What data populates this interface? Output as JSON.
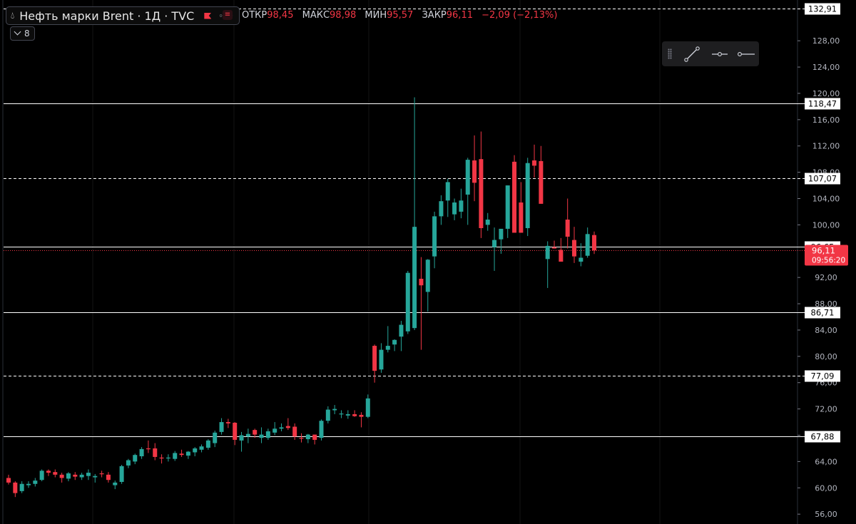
{
  "header": {
    "symbol_title": "Нефть марки Brent · 1Д · TVC",
    "ohlc": [
      {
        "label": "ОТКР",
        "value": "98,45"
      },
      {
        "label": "МАКС",
        "value": "98,98"
      },
      {
        "label": "МИН",
        "value": "95,57"
      },
      {
        "label": "ЗАКР",
        "value": "96,11"
      }
    ],
    "change": "−2,09 (−2,13%)",
    "collapse_count": "8"
  },
  "price_scale": {
    "ticks": [
      "128,00",
      "124,00",
      "120,00",
      "116,00",
      "112,00",
      "108,00",
      "104,00",
      "100,00",
      "92,00",
      "88,00",
      "84,00",
      "80,00",
      "76,00",
      "72,00",
      "68,00",
      "64,00",
      "60,00",
      "56,00"
    ],
    "range": [
      54.5,
      134.2
    ]
  },
  "levels": [
    {
      "label": "132,91",
      "value": 132.91,
      "style": "dashed"
    },
    {
      "label": "118,47",
      "value": 118.47,
      "style": "solid"
    },
    {
      "label": "107,07",
      "value": 107.07,
      "style": "dashed"
    },
    {
      "label": "96,65",
      "value": 96.65,
      "style": "solid"
    },
    {
      "label": "86,71",
      "value": 86.71,
      "style": "solid"
    },
    {
      "label": "77,09",
      "value": 77.09,
      "style": "dashed"
    },
    {
      "label": "67,88",
      "value": 67.88,
      "style": "solid"
    }
  ],
  "last_price": {
    "label": "96,11",
    "countdown": "09:56:20",
    "value": 96.11,
    "color": "#f23645"
  },
  "colors": {
    "up": "#26a69a",
    "down": "#f23645",
    "background": "#000000",
    "line": "#ffffff"
  },
  "toolbar": {
    "icons": [
      "drag-handle-icon",
      "trend-line-icon",
      "horizontal-ray-icon",
      "horizontal-line-icon"
    ]
  },
  "chart_data": {
    "type": "candlestick",
    "y_axis_ticks": [
      "128,00",
      "124,00",
      "120,00",
      "116,00",
      "112,00",
      "108,00",
      "104,00",
      "100,00",
      "92,00",
      "88,00",
      "84,00",
      "80,00",
      "76,00",
      "72,00",
      "68,00",
      "64,00",
      "60,00",
      "56,00"
    ],
    "candles": [
      [
        61.5,
        62.0,
        60.5,
        60.8
      ],
      [
        60.8,
        61.0,
        58.6,
        59.2
      ],
      [
        59.5,
        61.0,
        59.2,
        60.6
      ],
      [
        60.4,
        61.0,
        60.0,
        60.6
      ],
      [
        60.6,
        61.5,
        60.2,
        61.1
      ],
      [
        61.2,
        62.8,
        61.0,
        62.6
      ],
      [
        62.6,
        62.8,
        61.8,
        62.3
      ],
      [
        62.4,
        62.8,
        61.6,
        62.0
      ],
      [
        62.0,
        62.3,
        60.8,
        61.5
      ],
      [
        61.4,
        62.4,
        61.0,
        62.2
      ],
      [
        62.0,
        62.4,
        61.2,
        61.7
      ],
      [
        61.6,
        62.3,
        61.2,
        62.0
      ],
      [
        61.8,
        62.8,
        61.2,
        62.3
      ],
      [
        61.6,
        62.1,
        60.8,
        61.8
      ],
      [
        62.2,
        62.6,
        61.6,
        62.1
      ],
      [
        62.0,
        62.4,
        60.8,
        61.2
      ],
      [
        60.4,
        61.1,
        59.8,
        60.8
      ],
      [
        60.9,
        63.5,
        60.6,
        63.3
      ],
      [
        63.4,
        64.4,
        63.0,
        64.2
      ],
      [
        64.0,
        65.2,
        63.6,
        65.0
      ],
      [
        64.8,
        66.2,
        64.4,
        65.9
      ],
      [
        66.0,
        67.2,
        65.3,
        65.9
      ],
      [
        66.0,
        66.8,
        64.2,
        64.7
      ],
      [
        64.6,
        65.1,
        63.7,
        64.5
      ],
      [
        64.6,
        65.1,
        64.0,
        64.6
      ],
      [
        64.4,
        65.6,
        64.1,
        65.3
      ],
      [
        65.2,
        65.8,
        64.7,
        65.0
      ],
      [
        64.9,
        65.6,
        64.4,
        65.5
      ],
      [
        65.4,
        66.2,
        64.8,
        66.0
      ],
      [
        65.8,
        66.6,
        65.4,
        66.3
      ],
      [
        66.1,
        67.4,
        65.8,
        67.2
      ],
      [
        66.8,
        68.7,
        66.2,
        68.4
      ],
      [
        68.5,
        70.6,
        68.1,
        70.0
      ],
      [
        70.0,
        70.5,
        69.1,
        69.8
      ],
      [
        69.9,
        70.0,
        66.5,
        67.3
      ],
      [
        67.2,
        68.5,
        65.5,
        68.0
      ],
      [
        67.8,
        69.0,
        66.8,
        68.2
      ],
      [
        68.8,
        69.0,
        67.6,
        68.1
      ],
      [
        67.6,
        69.2,
        66.8,
        68.1
      ],
      [
        67.6,
        69.0,
        67.3,
        68.6
      ],
      [
        68.4,
        70.0,
        68.0,
        69.0
      ],
      [
        69.0,
        69.8,
        68.6,
        69.2
      ],
      [
        69.4,
        70.6,
        68.8,
        69.1
      ],
      [
        69.3,
        69.8,
        67.3,
        67.8
      ],
      [
        67.6,
        68.3,
        66.9,
        67.5
      ],
      [
        67.4,
        68.2,
        66.8,
        68.1
      ],
      [
        68.1,
        68.1,
        66.6,
        67.3
      ],
      [
        67.6,
        70.4,
        67.2,
        70.2
      ],
      [
        70.2,
        72.4,
        69.8,
        71.9
      ],
      [
        71.8,
        72.6,
        71.2,
        72.0
      ],
      [
        71.2,
        71.8,
        70.6,
        71.3
      ],
      [
        71.0,
        71.8,
        70.5,
        71.2
      ],
      [
        71.2,
        71.8,
        70.8,
        70.9
      ],
      [
        71.1,
        71.5,
        69.2,
        70.8
      ],
      [
        70.8,
        74.2,
        70.6,
        73.6
      ],
      [
        81.6,
        81.8,
        76.0,
        77.8
      ],
      [
        78.0,
        82.0,
        77.5,
        81.0
      ],
      [
        81.0,
        84.6,
        80.6,
        81.6
      ],
      [
        81.8,
        82.6,
        80.8,
        82.5
      ],
      [
        83.0,
        85.4,
        80.8,
        84.8
      ],
      [
        83.8,
        93.0,
        83.4,
        92.7
      ],
      [
        84.3,
        119.4,
        84.0,
        99.7
      ],
      [
        91.8,
        95.1,
        81.0,
        90.8
      ],
      [
        89.8,
        94.8,
        86.8,
        94.7
      ],
      [
        95.2,
        102.0,
        93.4,
        101.3
      ],
      [
        101.3,
        104.5,
        100.0,
        103.6
      ],
      [
        103.7,
        107.0,
        101.2,
        106.5
      ],
      [
        101.6,
        104.0,
        100.7,
        103.4
      ],
      [
        102.0,
        105.5,
        101.0,
        103.7
      ],
      [
        104.6,
        110.2,
        100.0,
        109.9
      ],
      [
        109.8,
        113.6,
        103.6,
        106.4
      ],
      [
        110.0,
        114.2,
        98.0,
        99.5
      ],
      [
        100.0,
        101.8,
        99.1,
        100.8
      ],
      [
        96.6,
        99.6,
        93.0,
        97.7
      ],
      [
        97.8,
        99.2,
        95.6,
        99.4
      ],
      [
        99.4,
        106.0,
        98.0,
        106.0
      ],
      [
        109.6,
        110.6,
        101.6,
        98.8
      ],
      [
        103.4,
        106.5,
        99.8,
        98.8
      ],
      [
        99.5,
        110.2,
        98.3,
        109.4
      ],
      [
        109.8,
        112.2,
        107.2,
        109.0
      ],
      [
        109.7,
        112.0,
        103.6,
        103.2
      ],
      [
        94.8,
        97.5,
        90.4,
        96.8
      ],
      [
        96.6,
        97.6,
        96.5,
        96.4
      ],
      [
        96.2,
        98.0,
        95.2,
        94.4
      ],
      [
        100.8,
        104.0,
        96.4,
        98.2
      ],
      [
        97.7,
        99.7,
        94.2,
        95.2
      ],
      [
        94.4,
        97.2,
        93.7,
        95.0
      ],
      [
        95.3,
        99.6,
        95.0,
        98.6
      ],
      [
        98.45,
        98.98,
        95.57,
        96.11
      ]
    ]
  }
}
